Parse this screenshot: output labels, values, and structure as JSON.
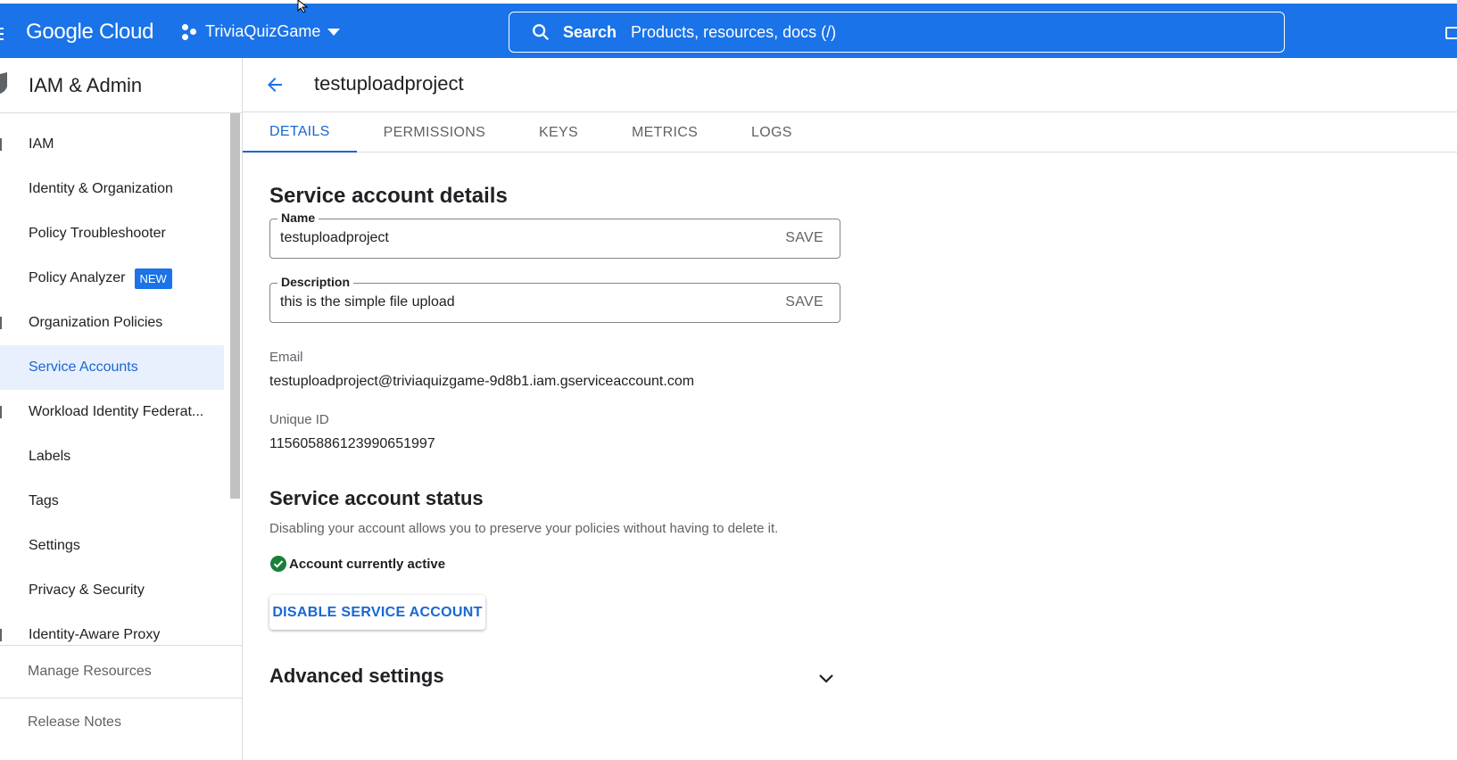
{
  "topbar": {
    "logo": "Google Cloud",
    "project": "TriviaQuizGame",
    "search_label": "Search",
    "search_placeholder": "Products, resources, docs (/)"
  },
  "sidebar": {
    "title": "IAM & Admin",
    "items": [
      {
        "label": "IAM"
      },
      {
        "label": "Identity & Organization"
      },
      {
        "label": "Policy Troubleshooter"
      },
      {
        "label": "Policy Analyzer",
        "badge": "NEW"
      },
      {
        "label": "Organization Policies"
      },
      {
        "label": "Service Accounts",
        "active": true
      },
      {
        "label": "Workload Identity Federat..."
      },
      {
        "label": "Labels"
      },
      {
        "label": "Tags"
      },
      {
        "label": "Settings"
      },
      {
        "label": "Privacy & Security"
      },
      {
        "label": "Identity-Aware Proxy"
      }
    ],
    "footer": {
      "manage_resources": "Manage Resources",
      "release_notes": "Release Notes"
    }
  },
  "page": {
    "title": "testuploadproject",
    "tabs": [
      "DETAILS",
      "PERMISSIONS",
      "KEYS",
      "METRICS",
      "LOGS"
    ],
    "active_tab": "DETAILS"
  },
  "details": {
    "heading": "Service account details",
    "name_label": "Name",
    "name_value": "testuploadproject",
    "description_label": "Description",
    "description_value": "this is the simple file upload",
    "save_label": "SAVE",
    "email_label": "Email",
    "email_value": "testuploadproject@triviaquizgame-9d8b1.iam.gserviceaccount.com",
    "unique_id_label": "Unique ID",
    "unique_id_value": "115605886123990651997"
  },
  "status": {
    "heading": "Service account status",
    "description": "Disabling your account allows you to preserve your policies without having to delete it.",
    "state": "Account currently active",
    "disable_button": "DISABLE SERVICE ACCOUNT"
  },
  "advanced": {
    "heading": "Advanced settings"
  },
  "colors": {
    "brand_blue": "#1a73e8",
    "active_text": "#1967d2",
    "active_bg": "#e8f0fe",
    "success_green": "#188038"
  },
  "icons": [
    "menu-icon",
    "project-dots-icon",
    "search-icon",
    "terminal-icon",
    "shield-icon",
    "back-arrow-icon",
    "check-circle-icon",
    "chevron-down-icon",
    "mouse-cursor-icon"
  ]
}
